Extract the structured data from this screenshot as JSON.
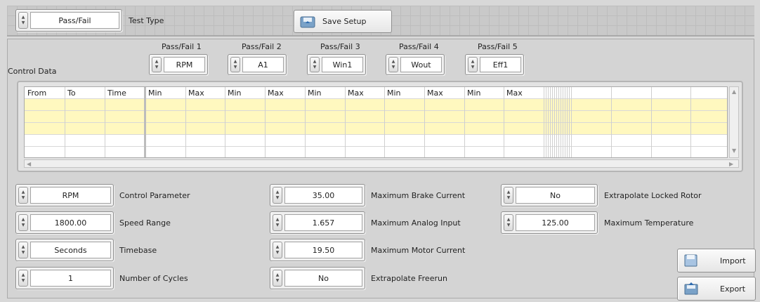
{
  "test_type": {
    "value": "Pass/Fail",
    "label": "Test Type"
  },
  "save_setup": {
    "label": "Save Setup"
  },
  "control_data": {
    "title": "Control Data"
  },
  "pass_fail": [
    {
      "label": "Pass/Fail 1",
      "value": "RPM"
    },
    {
      "label": "Pass/Fail 2",
      "value": "A1"
    },
    {
      "label": "Pass/Fail 3",
      "value": "Win1"
    },
    {
      "label": "Pass/Fail 4",
      "value": "Wout"
    },
    {
      "label": "Pass/Fail 5",
      "value": "Eff1"
    }
  ],
  "table": {
    "headers": [
      "From",
      "To",
      "Time",
      "Min",
      "Max",
      "Min",
      "Max",
      "Min",
      "Max",
      "Min",
      "Max",
      "Min",
      "Max"
    ],
    "row_count": 6,
    "yellow_rows": 3
  },
  "settings": {
    "control_parameter": {
      "value": "RPM",
      "label": "Control Parameter"
    },
    "speed_range": {
      "value": "1800.00",
      "label": "Speed Range"
    },
    "timebase": {
      "value": "Seconds",
      "label": "Timebase"
    },
    "number_of_cycles": {
      "value": "1",
      "label": "Number of Cycles"
    },
    "max_brake_current": {
      "value": "35.00",
      "label": "Maximum Brake Current"
    },
    "max_analog_input": {
      "value": "1.657",
      "label": "Maximum Analog Input"
    },
    "max_motor_current": {
      "value": "19.50",
      "label": "Maximum Motor Current"
    },
    "extrapolate_freerun": {
      "value": "No",
      "label": "Extrapolate Freerun"
    },
    "extrapolate_locked_rotor": {
      "value": "No",
      "label": "Extrapolate Locked Rotor"
    },
    "max_temperature": {
      "value": "125.00",
      "label": "Maximum Temperature"
    }
  },
  "actions": {
    "import": "Import",
    "export": "Export"
  },
  "icons": {
    "spinner": "increment-decrement-icon",
    "save": "save-disk-icon",
    "import": "import-icon",
    "export": "export-icon"
  }
}
